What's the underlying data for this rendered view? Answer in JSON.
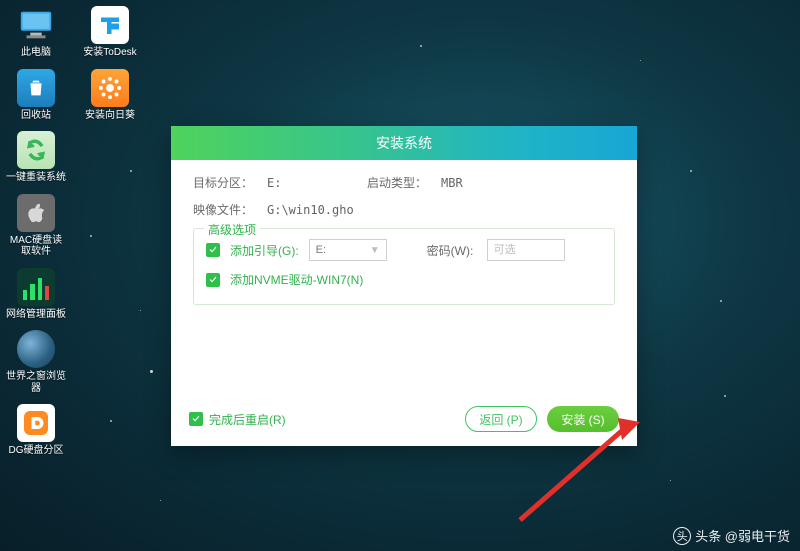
{
  "desktop": {
    "col1": [
      {
        "label": "此电脑"
      },
      {
        "label": "回收站"
      },
      {
        "label": "一键重装系统"
      },
      {
        "label": "MAC硬盘读\n取软件"
      },
      {
        "label": "网络管理面板"
      },
      {
        "label": "世界之窗浏览\n器"
      },
      {
        "label": "DG硬盘分区"
      }
    ],
    "col2": [
      {
        "label": "安装ToDesk"
      },
      {
        "label": "安装向日葵"
      }
    ]
  },
  "dialog": {
    "title": "安装系统",
    "target_label": "目标分区：",
    "target_value": "E:",
    "boot_label": "启动类型：",
    "boot_value": "MBR",
    "image_label": "映像文件：",
    "image_value": "G:\\win10.gho",
    "adv_title": "高级选项",
    "add_boot_label": "添加引导(G):",
    "add_boot_selected": "E:",
    "password_label": "密码(W):",
    "password_placeholder": "可选",
    "add_nvme_label": "添加NVME驱动-WIN7(N)",
    "restart_label": "完成后重启(R)",
    "back_btn": "返回 (P)",
    "install_btn": "安装 (S)"
  },
  "watermark": "头条 @弱电干货"
}
